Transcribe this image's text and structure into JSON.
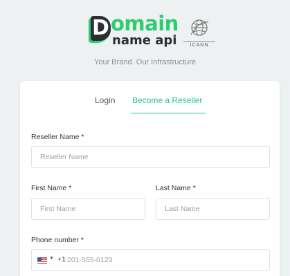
{
  "brand": {
    "logo_letter": "D",
    "logo_word_top": "omain",
    "logo_word_bottom": "name api",
    "icann_label": "ICANN",
    "tagline": "Your Brand. Our Infrastructure",
    "colors": {
      "green": "#2ecc71",
      "dark": "#2b2f33",
      "accent": "#22c28a"
    }
  },
  "tabs": [
    {
      "label": "Login",
      "active": false
    },
    {
      "label": "Become a Reseller",
      "active": true
    }
  ],
  "form": {
    "reseller_name": {
      "label": "Reseller Name *",
      "placeholder": "Reseller Name",
      "value": ""
    },
    "first_name": {
      "label": "First Name *",
      "placeholder": "First Name",
      "value": ""
    },
    "last_name": {
      "label": "Last Name *",
      "placeholder": "Last Name",
      "value": ""
    },
    "phone": {
      "label": "Phone number *",
      "country_flag": "us-flag-icon",
      "dial_code": "+1",
      "placeholder": "201-555-0123",
      "value": ""
    }
  }
}
